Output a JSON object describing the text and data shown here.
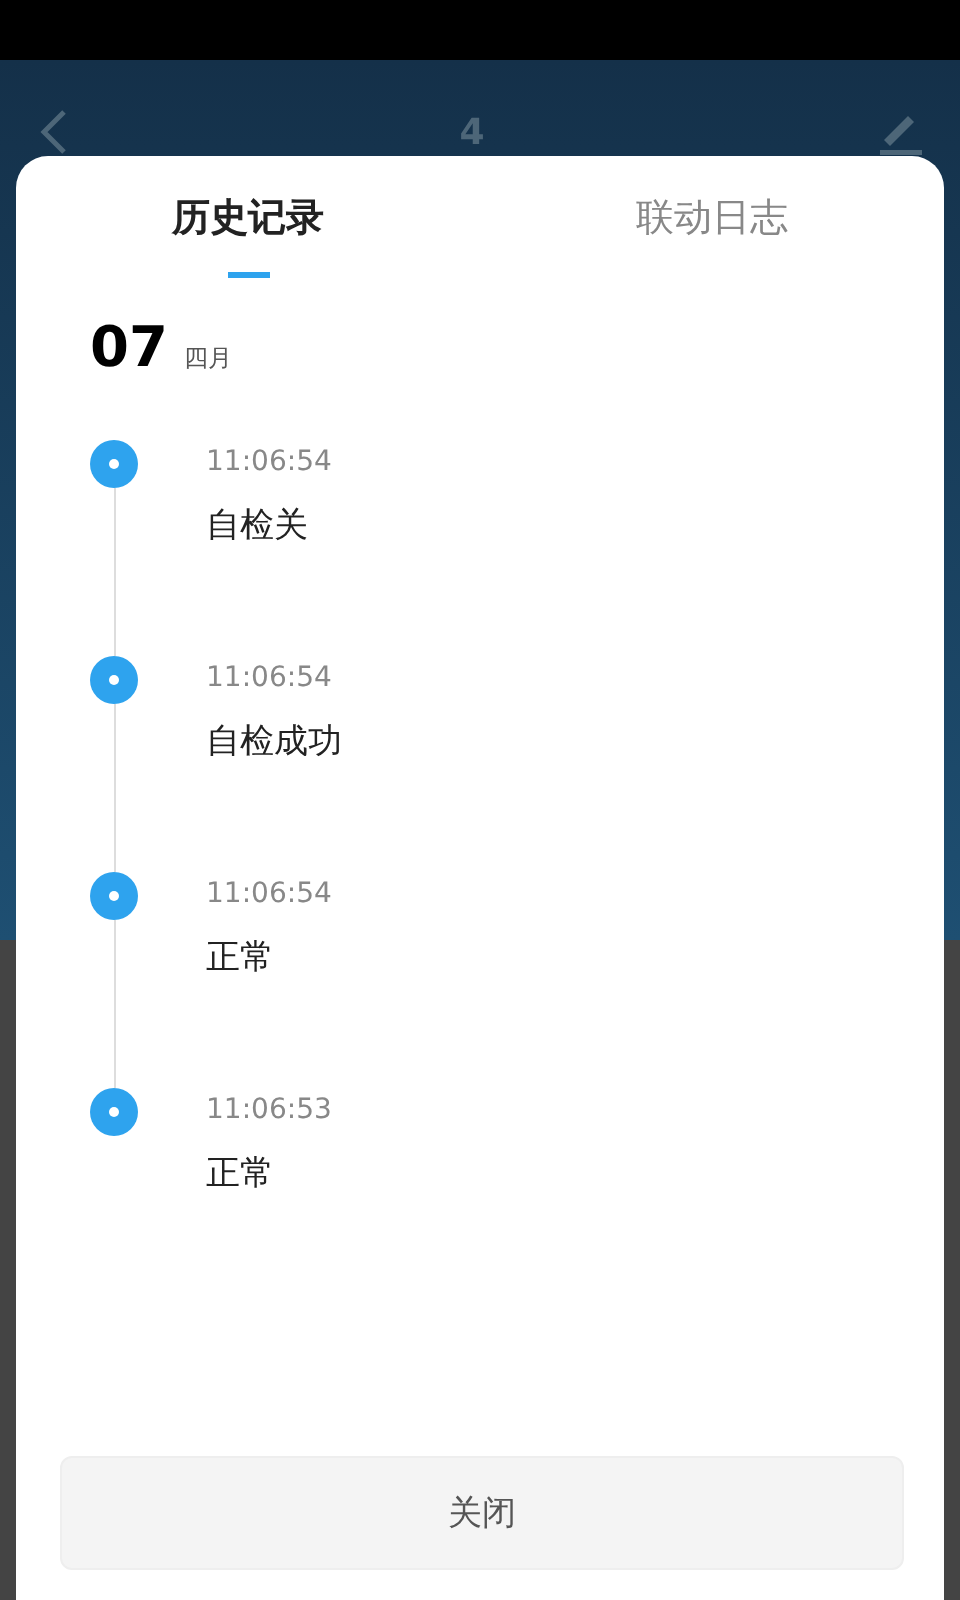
{
  "header": {
    "title": "4"
  },
  "tabs": [
    {
      "label": "历史记录",
      "selected": true
    },
    {
      "label": "联动日志",
      "selected": false
    }
  ],
  "date": {
    "day": "07",
    "month": "四月"
  },
  "records": [
    {
      "time": "11:06:54",
      "text": "自检关"
    },
    {
      "time": "11:06:54",
      "text": "自检成功"
    },
    {
      "time": "11:06:54",
      "text": "正常"
    },
    {
      "time": "11:06:53",
      "text": "正常"
    }
  ],
  "close_button": "关闭"
}
